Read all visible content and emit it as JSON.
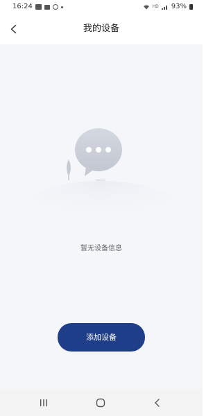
{
  "status_bar": {
    "time": "16:24",
    "battery": "93%",
    "icons": [
      "gallery-icon",
      "message-icon",
      "sync-icon",
      "dot-icon",
      "wifi-icon",
      "hd-icon",
      "signal-icon",
      "battery-icon"
    ]
  },
  "header": {
    "title": "我的设备",
    "back_icon": "chevron-left-icon"
  },
  "main": {
    "empty_text": "暂无设备信息",
    "add_button_label": "添加设备",
    "illustration": "chat-bubble-empty-illustration"
  },
  "nav_bar": {
    "icons": [
      "recent-apps-icon",
      "home-icon",
      "back-icon"
    ]
  },
  "colors": {
    "accent": "#1f3e8a",
    "content_bg": "#f4f6f9",
    "nav_bg": "#f3f3f3"
  }
}
